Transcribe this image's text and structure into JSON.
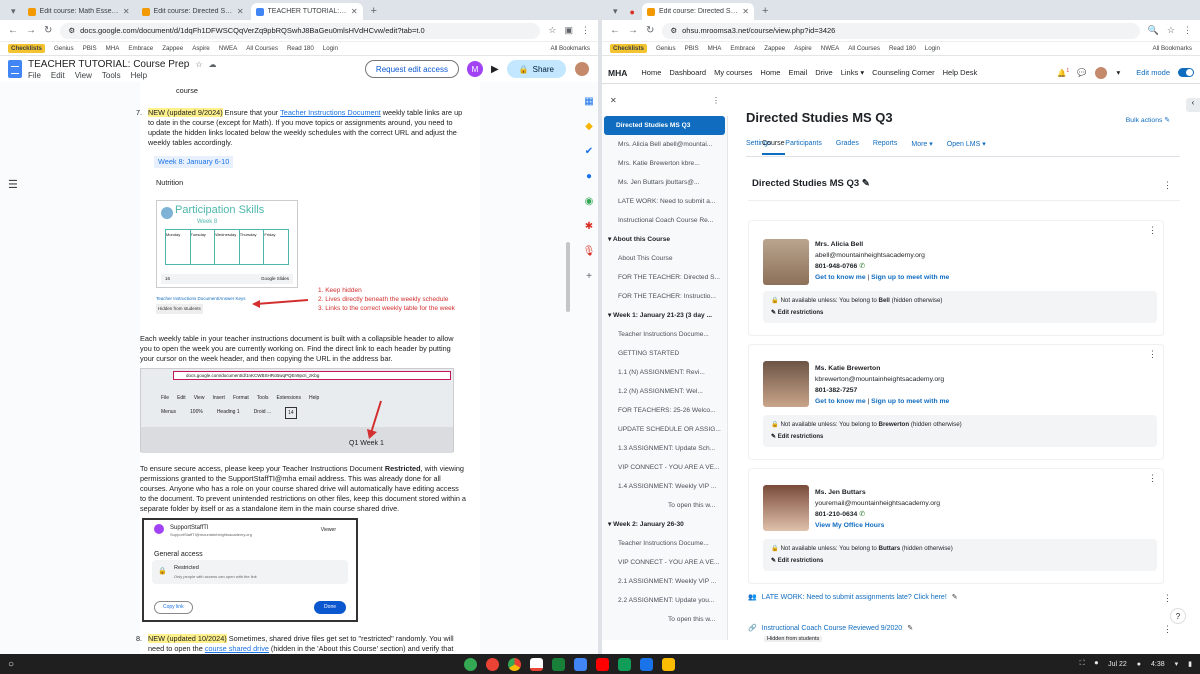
{
  "left_window": {
    "tabs": [
      {
        "title": "Edit course: Math Essential Ele",
        "color": "#f29900",
        "active": false
      },
      {
        "title": "Edit course: Directed Studies M",
        "color": "#f29900",
        "active": false
      },
      {
        "title": "TEACHER TUTORIAL: Course P",
        "color": "#4285f4",
        "active": true
      }
    ],
    "url": "docs.google.com/document/d/1dqFh1DFWSCQqVerZq9pbRQSwhJ8BaGeu0mlsHVdHCvw/edit?tab=t.0",
    "bookmarks": [
      "Checklists",
      "Genius",
      "PBIS",
      "MHA",
      "Embrace",
      "Zappee",
      "Aspire",
      "NWEA",
      "All Courses",
      "Read 180",
      "Login"
    ],
    "bookmarks_right": "All Bookmarks",
    "doc": {
      "title": "TEACHER TUTORIAL: Course Prep",
      "menu": [
        "File",
        "Edit",
        "View",
        "Tools",
        "Help"
      ],
      "request_edit": "Request edit access",
      "share": "Share",
      "user_initial": "M",
      "course_word": "course",
      "step7_num": "7.",
      "step7_hl": "NEW (updated 9/2024)",
      "step7_pre": " Ensure that your ",
      "step7_link": "Teacher Instructions Document",
      "step7_post": " weekly table links are up to date in the course (except for Math). If you move topics or assignments around, you need to update the hidden links located below the weekly schedules with the correct URL and adjust the weekly tables accordingly.",
      "week_label": "Week 8: January 6-10",
      "nutrition": "Nutrition",
      "img1_title": "Participation Skills",
      "img1_sub": "Week 8",
      "img1_days": [
        "Monday",
        "Tuesday",
        "Wednesday",
        "Thursday",
        "Friday"
      ],
      "img1_page": "16",
      "img1_app": "Google Slides",
      "img1_link": "Teacher Instructions Document/Answer Keys",
      "img1_badge": "Hidden from students",
      "notes": [
        "1. Keep hidden",
        "2. Lives directly beneath the weekly schedule",
        "3. Links to the correct weekly table for the week"
      ],
      "para2": "Each weekly table in your teacher instructions document is built with a collapsible header to allow you to open the week you are currently working on. Find the direct link to each header by putting your cursor on the week header, and then copying the URL in the address bar.",
      "img2_url": "docs.google.com/document/d/1nKCWBSHRcBwqPQEn9pcIi_zKbg",
      "img2_menu": [
        "File",
        "Edit",
        "View",
        "Insert",
        "Format",
        "Tools",
        "Extensions",
        "Help"
      ],
      "img2_toolbar": [
        "Menus",
        "100%",
        "Heading 1",
        "Droid ...",
        "14"
      ],
      "img2_heading": "Q1 Week 1",
      "para3_pre": "To ensure secure access, please keep your Teacher Instructions Document ",
      "para3_bold": "Restricted",
      "para3_post": ", with viewing permissions granted to the SupportStaffTI@mha email address. This was already done for all courses. Anyone who has a role on your course shared drive will automatically have editing access to the document. To prevent unintended restrictions on other files, keep this document stored within a separate folder by itself or as a standalone item in the main course shared drive.",
      "img3_name": "SupportStaffTI",
      "img3_email": "SupportStaffTI@mountainheightsacademy.org",
      "img3_role": "Viewer",
      "img3_general": "General access",
      "img3_restricted": "Restricted",
      "img3_restricted_sub": "Only people with access can open with the link",
      "img3_copy": "Copy link",
      "img3_done": "Done",
      "step8_num": "8.",
      "step8_hl": "NEW (updated 10/2024)",
      "step8_text": " Sometimes, shared drive files get set to \"restricted\" randomly. You will need to open the ",
      "step8_link": "course shared drive",
      "step8_tail": " (hidden in the 'About this Course' section) and verify that"
    }
  },
  "right_window": {
    "tabs": [
      {
        "title": "Edit course: Directed Studies M",
        "color": "#f29900",
        "active": true
      }
    ],
    "url": "ohsu.mroomsa3.net/course/view.php?id=3426",
    "bookmarks": [
      "Checklists",
      "Genius",
      "PBIS",
      "MHA",
      "Embrace",
      "Zappee",
      "Aspire",
      "NWEA",
      "All Courses",
      "Read 180",
      "Login"
    ],
    "bookmarks_right": "All Bookmarks",
    "nav": {
      "brand": "MHA",
      "items": [
        "Home",
        "Dashboard",
        "My courses",
        "Home",
        "Email",
        "Drive",
        "Links",
        "Counseling Corner",
        "Help Desk"
      ],
      "edit_mode": "Edit mode",
      "notif_count": "1"
    },
    "index": {
      "selected": "Directed Studies MS Q3",
      "items": [
        "Mrs. Alicia Bell abell@mountai...",
        "Mrs. Katie Brewerton kbre...",
        "Ms. Jen Buttars jbuttars@...",
        "LATE WORK: Need to submit a...",
        "Instructional Coach Course Re..."
      ],
      "sec1": "About this Course",
      "sec1_items": [
        "About This Course",
        "FOR THE TEACHER: Directed S...",
        "FOR THE TEACHER: Instructio..."
      ],
      "sec2": "Week 1: January 21-23 (3 day ...",
      "sec2_items": [
        "Teacher Instructions Docume...",
        "GETTING STARTED",
        "1.1 (N) ASSIGNMENT: Revi...",
        "1.2 (N) ASSIGNMENT: Wel...",
        "FOR TEACHERS: 25-26 Welco...",
        "UPDATE SCHEDULE OR ASSIG...",
        "1.3 ASSIGNMENT: Update Sch...",
        "VIP CONNECT - YOU ARE A VE...",
        "1.4 ASSIGNMENT: Weekly VIP ...",
        "To open this w..."
      ],
      "sec3": "Week 2: January 26-30",
      "sec3_items": [
        "Teacher Instructions Docume...",
        "VIP CONNECT - YOU ARE A VE...",
        "2.1 ASSIGNMENT: Weekly VIP ...",
        "2.2 ASSIGNMENT: Update you...",
        "To open this w..."
      ]
    },
    "course": {
      "title": "Directed Studies MS Q3",
      "bulk": "Bulk actions",
      "tabs": [
        "Course",
        "Settings",
        "Participants",
        "Grades",
        "Reports",
        "More",
        "Open LMS"
      ],
      "section_title": "Directed Studies MS Q3",
      "teachers": [
        {
          "name": "Mrs. Alicia Bell",
          "email": "abell@mountainheightsacademy.org",
          "phone": "801-948-0766",
          "link": "Get to know me",
          "link2": "Sign up to meet with me",
          "restr_pre": "Not available unless: You belong to ",
          "restr_group": "Bell",
          "restr_post": " (hidden otherwise)",
          "edit": "Edit restrictions"
        },
        {
          "name": "Ms. Katie Brewerton",
          "email": "kbrewerton@mountainheightsacademy.org",
          "phone": "801-382-7257",
          "link": "Get to know me",
          "link2": "Sign up to meet with me",
          "restr_pre": "Not available unless: You belong to ",
          "restr_group": "Brewerton",
          "restr_post": " (hidden otherwise)",
          "edit": "Edit restrictions"
        },
        {
          "name": "Ms. Jen Buttars",
          "email": "youremail@mountainheightsacademy.org",
          "phone": "801-210-0634",
          "link": "View My Office Hours",
          "link2": "",
          "restr_pre": "Not available unless: You belong to ",
          "restr_group": "Buttars",
          "restr_post": " (hidden otherwise)",
          "edit": "Edit restrictions"
        }
      ],
      "late_work": "LATE WORK: Need to submit assignments late? Click here!",
      "coach": "Instructional Coach Course Reviewed 9/2020",
      "hidden_badge": "Hidden from students",
      "help": "?"
    }
  },
  "taskbar": {
    "date": "Jul 22",
    "time": "4:38"
  }
}
